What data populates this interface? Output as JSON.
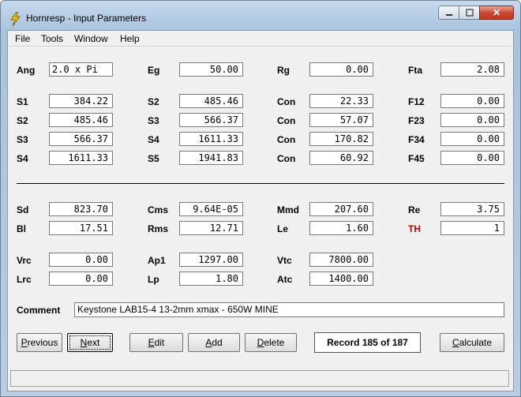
{
  "window": {
    "title": "Hornresp - Input Parameters",
    "close_glyph": "✕"
  },
  "menu": [
    "File",
    "Tools",
    "Window",
    "Help"
  ],
  "params": {
    "Ang": "2.0 x Pi",
    "Eg": "50.00",
    "Rg": "0.00",
    "Fta": "2.08",
    "row1": {
      "S1": "384.22",
      "S2": "485.46",
      "Con": "22.33",
      "F12": "0.00"
    },
    "row2": {
      "S2": "485.46",
      "S3": "566.37",
      "Con": "57.07",
      "F23": "0.00"
    },
    "row3": {
      "S3": "566.37",
      "S4": "1611.33",
      "Con": "170.82",
      "F34": "0.00"
    },
    "row4": {
      "S4": "1611.33",
      "S5": "1941.83",
      "Con": "60.92",
      "F45": "0.00"
    },
    "Sd": "823.70",
    "Cms": "9.64E-05",
    "Mmd": "207.60",
    "Re": "3.75",
    "Bl": "17.51",
    "Rms": "12.71",
    "Le": "1.60",
    "TH": "1",
    "Vrc": "0.00",
    "Ap1": "1297.00",
    "Vtc": "7800.00",
    "Lrc": "0.00",
    "Lp": "1.80",
    "Atc": "1400.00"
  },
  "labels": {
    "Ang": "Ang",
    "Eg": "Eg",
    "Rg": "Rg",
    "Fta": "Fta",
    "S1": "S1",
    "S2": "S2",
    "S3": "S3",
    "S4": "S4",
    "S5": "S5",
    "Con": "Con",
    "F12": "F12",
    "F23": "F23",
    "F34": "F34",
    "F45": "F45",
    "Sd": "Sd",
    "Cms": "Cms",
    "Mmd": "Mmd",
    "Re": "Re",
    "Bl": "Bl",
    "Rms": "Rms",
    "Le": "Le",
    "TH": "TH",
    "Vrc": "Vrc",
    "Ap1": "Ap1",
    "Vtc": "Vtc",
    "Lrc": "Lrc",
    "Lp": "Lp",
    "Atc": "Atc",
    "Comment": "Comment"
  },
  "comment": "Keystone LAB15-4 13-2mm xmax - 650W MINE",
  "buttons": {
    "previous_first": "P",
    "previous_rest": "revious",
    "next_first": "N",
    "next_rest": "ext",
    "edit_first": "E",
    "edit_rest": "dit",
    "add_first": "A",
    "add_rest": "dd",
    "delete_first": "D",
    "delete_rest": "elete",
    "calculate_first": "C",
    "calculate_rest": "alculate"
  },
  "record": "Record 185 of 187",
  "colors": {
    "th_label": "#c00000",
    "accent_icon": "#f2c200"
  }
}
